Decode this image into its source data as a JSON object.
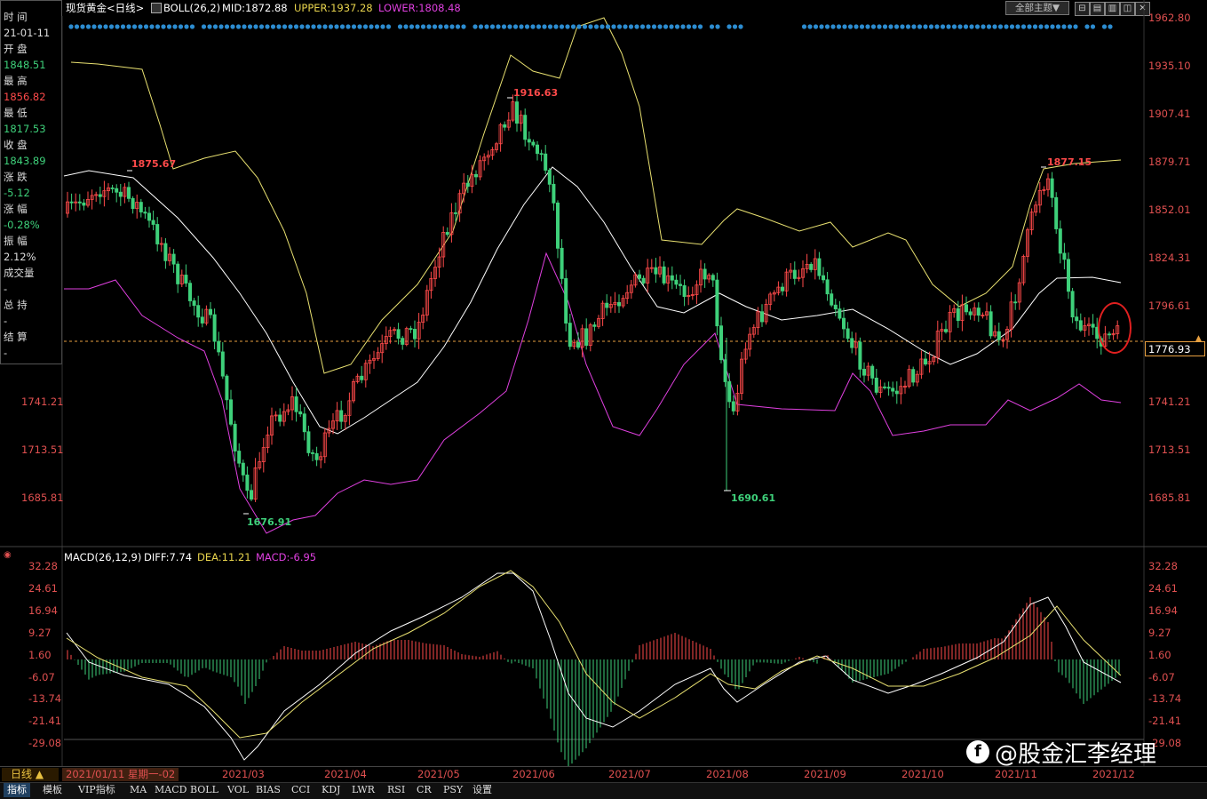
{
  "header": {
    "title": "现货黄金<日线>",
    "indicator": "BOLL(26,2)",
    "mid": "MID:1872.88",
    "upper": "UPPER:1937.28",
    "lower": "LOWER:1808.48",
    "theme_button": "全部主题▼"
  },
  "info_panel": [
    {
      "label": "时 间",
      "value": "21-01-11",
      "value_color": "white"
    },
    {
      "label": "开 盘",
      "value": "1848.51",
      "value_color": "green"
    },
    {
      "label": "最 高",
      "value": "1856.82",
      "value_color": "red"
    },
    {
      "label": "最 低",
      "value": "1817.53",
      "value_color": "green"
    },
    {
      "label": "收 盘",
      "value": "1843.89",
      "value_color": "green"
    },
    {
      "label": "涨 跌",
      "value": "-5.12",
      "value_color": "green"
    },
    {
      "label": "涨 幅",
      "value": "-0.28%",
      "value_color": "green"
    },
    {
      "label": "振 幅",
      "value": "2.12%",
      "value_color": "white"
    },
    {
      "label": "成交量",
      "value": "-",
      "value_color": "white"
    },
    {
      "label": "总 持",
      "value": "-",
      "value_color": "white"
    },
    {
      "label": "结 算",
      "value": "-",
      "value_color": "white"
    }
  ],
  "price_axis": [
    "1962.80",
    "1935.10",
    "1907.41",
    "1879.71",
    "1852.01",
    "1824.31",
    "1796.61",
    "1741.21",
    "1713.51",
    "1685.81"
  ],
  "left_axis": [
    "1741.21",
    "1713.51",
    "1685.81"
  ],
  "current_price": "1776.93",
  "annotations": {
    "high_jan": "1875.67",
    "low_mar": "1676.91",
    "high_jun": "1916.63",
    "low_aug": "1690.61",
    "high_nov": "1877.15"
  },
  "macd": {
    "title": "MACD(26,12,9)",
    "diff": "DIFF:7.74",
    "dea": "DEA:11.21",
    "macd": "MACD:-6.95",
    "axis": [
      "32.28",
      "24.61",
      "16.94",
      "9.27",
      "1.60",
      "-6.07",
      "-13.74",
      "-21.41",
      "-29.08"
    ]
  },
  "x_axis": {
    "cursor_date": "2021/01/11 星期一-02",
    "labels": [
      "2021/03",
      "2021/04",
      "2021/05",
      "2021/06",
      "2021/07",
      "2021/08",
      "2021/09",
      "2021/10",
      "2021/11",
      "2021/12"
    ]
  },
  "period_button": "日线 ▲",
  "bottom_tabs": [
    "指标",
    "模板",
    "VIP指标",
    "MA",
    "MACD",
    "BOLL",
    "VOL",
    "BIAS",
    "CCI",
    "KDJ",
    "LWR",
    "RSI",
    "CR",
    "PSY",
    "设置"
  ],
  "watermark": "@股金汇李经理",
  "colors": {
    "up": "#ff4a4a",
    "down": "#3ed07a",
    "upper": "#e8e070",
    "mid": "#ffffff",
    "lower": "#e040e0",
    "diff": "#ffffff",
    "dea": "#e8e070"
  }
}
